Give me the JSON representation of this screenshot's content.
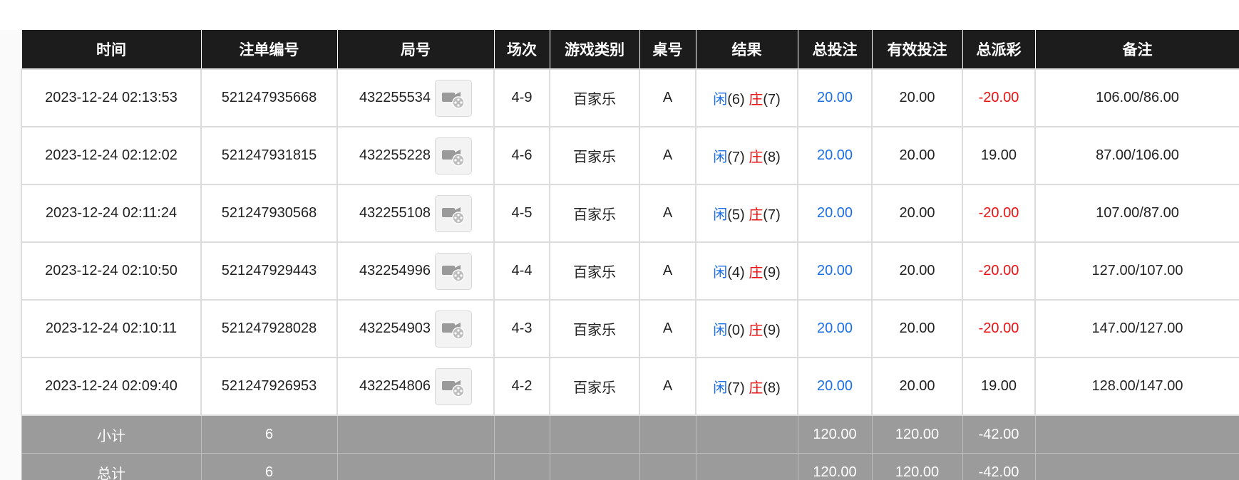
{
  "table": {
    "headers": [
      "时间",
      "注单编号",
      "局号",
      "场次",
      "游戏类别",
      "桌号",
      "结果",
      "总投注",
      "有效投注",
      "总派彩",
      "备注"
    ],
    "rows": [
      {
        "time": "2023-12-24 02:13:53",
        "order_no": "521247935668",
        "round_no": "432255534",
        "session": "4-9",
        "game": "百家乐",
        "table": "A",
        "player_label": "闲",
        "player_val": "(6)",
        "banker_label": "庄",
        "banker_val": "(7)",
        "total_bet": "20.00",
        "valid_bet": "20.00",
        "payout": "-20.00",
        "payout_negative": true,
        "note": "106.00/86.00"
      },
      {
        "time": "2023-12-24 02:12:02",
        "order_no": "521247931815",
        "round_no": "432255228",
        "session": "4-6",
        "game": "百家乐",
        "table": "A",
        "player_label": "闲",
        "player_val": "(7)",
        "banker_label": "庄",
        "banker_val": "(8)",
        "total_bet": "20.00",
        "valid_bet": "20.00",
        "payout": "19.00",
        "payout_negative": false,
        "note": "87.00/106.00"
      },
      {
        "time": "2023-12-24 02:11:24",
        "order_no": "521247930568",
        "round_no": "432255108",
        "session": "4-5",
        "game": "百家乐",
        "table": "A",
        "player_label": "闲",
        "player_val": "(5)",
        "banker_label": "庄",
        "banker_val": "(7)",
        "total_bet": "20.00",
        "valid_bet": "20.00",
        "payout": "-20.00",
        "payout_negative": true,
        "note": "107.00/87.00"
      },
      {
        "time": "2023-12-24 02:10:50",
        "order_no": "521247929443",
        "round_no": "432254996",
        "session": "4-4",
        "game": "百家乐",
        "table": "A",
        "player_label": "闲",
        "player_val": "(4)",
        "banker_label": "庄",
        "banker_val": "(9)",
        "total_bet": "20.00",
        "valid_bet": "20.00",
        "payout": "-20.00",
        "payout_negative": true,
        "note": "127.00/107.00"
      },
      {
        "time": "2023-12-24 02:10:11",
        "order_no": "521247928028",
        "round_no": "432254903",
        "session": "4-3",
        "game": "百家乐",
        "table": "A",
        "player_label": "闲",
        "player_val": "(0)",
        "banker_label": "庄",
        "banker_val": "(9)",
        "total_bet": "20.00",
        "valid_bet": "20.00",
        "payout": "-20.00",
        "payout_negative": true,
        "note": "147.00/127.00"
      },
      {
        "time": "2023-12-24 02:09:40",
        "order_no": "521247926953",
        "round_no": "432254806",
        "session": "4-2",
        "game": "百家乐",
        "table": "A",
        "player_label": "闲",
        "player_val": "(7)",
        "banker_label": "庄",
        "banker_val": "(8)",
        "total_bet": "20.00",
        "valid_bet": "20.00",
        "payout": "19.00",
        "payout_negative": false,
        "note": "128.00/147.00"
      }
    ],
    "subtotal": {
      "label": "小计",
      "count": "6",
      "total_bet": "120.00",
      "valid_bet": "120.00",
      "payout": "-42.00"
    },
    "grandtotal": {
      "label": "总计",
      "count": "6",
      "total_bet": "120.00",
      "valid_bet": "120.00",
      "payout": "-42.00"
    }
  },
  "colors": {
    "header_bg": "#1c1c1c",
    "player": "#1a6ee6",
    "banker": "#ee1111",
    "negative": "#ee1111",
    "summary_bg": "#9b9b9b"
  },
  "icons": {
    "replay": "video-replay-icon"
  }
}
